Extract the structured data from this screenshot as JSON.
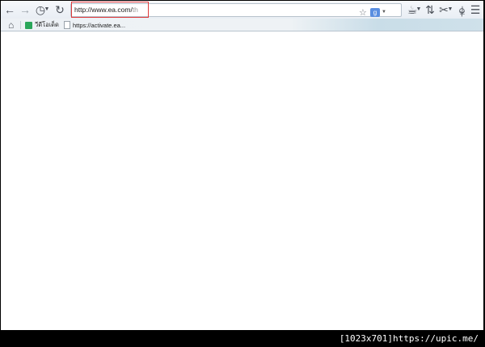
{
  "toolbar": {
    "back_icon": "arrow-left-icon",
    "forward_icon": "arrow-right-icon",
    "history_icon": "history-clock-icon",
    "reload_icon": "reload-icon",
    "bookmark_star_icon": "star-icon",
    "search_engine_icon": "google-search-icon",
    "search_icon": "magnifier-icon",
    "download_icon": "download-icon",
    "menu_icon": "hamburger-menu-icon"
  },
  "urlbar": {
    "value": "http://www.ea.com/",
    "autocomplete_hint": "th"
  },
  "bookmarks": {
    "items": [
      {
        "label": "วีดีโอเด็ด",
        "icon": "green-favicon"
      },
      {
        "label": "https://activate.ea...",
        "icon": "page-favicon"
      }
    ]
  },
  "watermark": {
    "text": "[1023x701]https://upic.me/"
  },
  "colors": {
    "highlight_border": "#e03a3a",
    "toolbar_bg": "#eef2f5"
  }
}
